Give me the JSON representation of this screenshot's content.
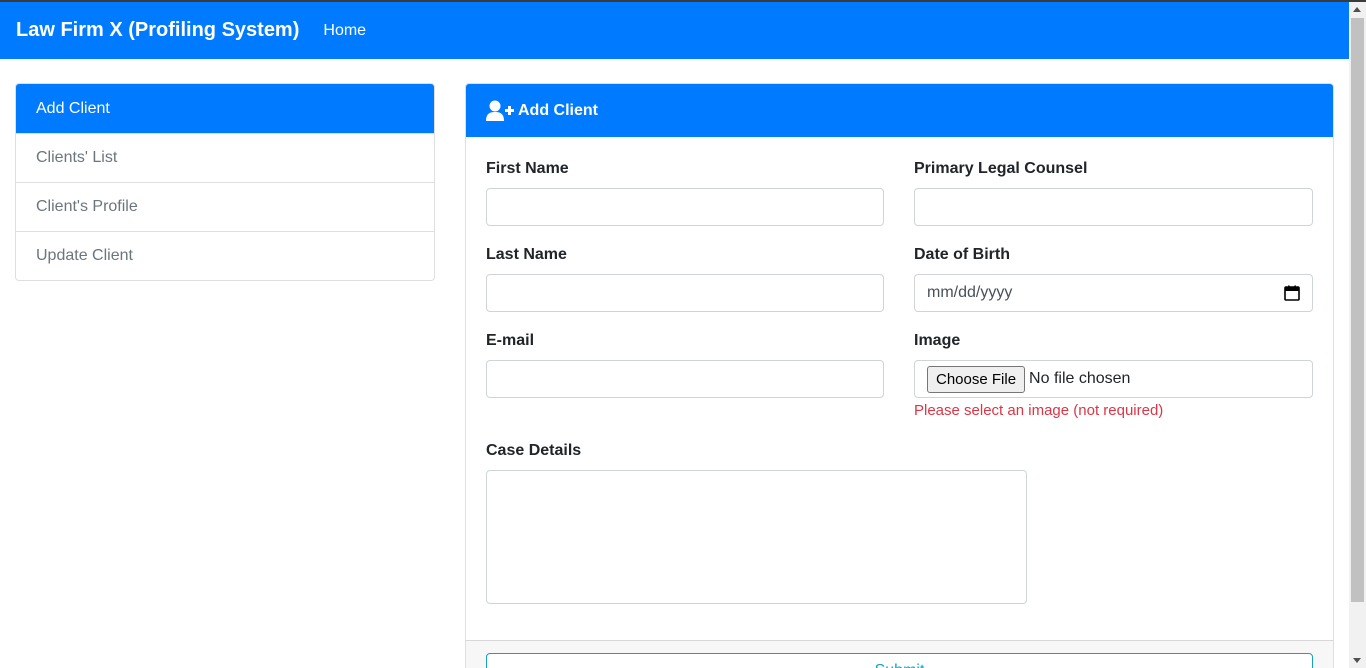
{
  "navbar": {
    "brand": "Law Firm X (Profiling System)",
    "home_label": "Home"
  },
  "sidebar": {
    "items": [
      {
        "label": "Add Client",
        "active": true
      },
      {
        "label": "Clients' List",
        "active": false
      },
      {
        "label": "Client's Profile",
        "active": false
      },
      {
        "label": "Update Client",
        "active": false
      }
    ]
  },
  "card": {
    "header_title": "Add Client",
    "header_icon": "user-plus-icon"
  },
  "form": {
    "first_name": {
      "label": "First Name",
      "value": ""
    },
    "primary_counsel": {
      "label": "Primary Legal Counsel",
      "value": ""
    },
    "last_name": {
      "label": "Last Name",
      "value": ""
    },
    "dob": {
      "label": "Date of Birth",
      "placeholder": "mm/dd/yyyy"
    },
    "email": {
      "label": "E-mail",
      "value": ""
    },
    "image": {
      "label": "Image",
      "button_label": "Choose File",
      "status": "No file chosen",
      "hint": "Please select an image (not required)"
    },
    "case_details": {
      "label": "Case Details",
      "value": ""
    },
    "submit_label": "Submit"
  },
  "colors": {
    "primary": "#007bff",
    "danger": "#dc3545",
    "info": "#17a2b8"
  }
}
